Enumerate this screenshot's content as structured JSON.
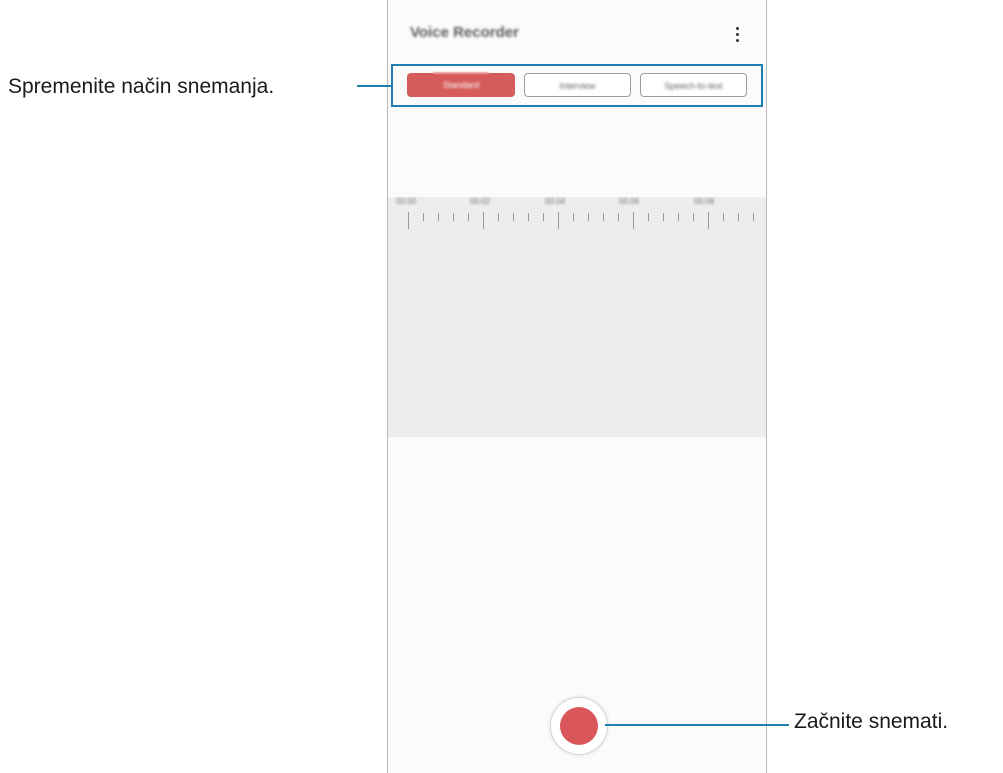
{
  "app": {
    "title": "Voice Recorder"
  },
  "modes": [
    {
      "label": "Standard",
      "selected": true
    },
    {
      "label": "Interview",
      "selected": false
    },
    {
      "label": "Speech-to-text",
      "selected": false
    }
  ],
  "timeline": {
    "tick_labels": [
      "00:00",
      "00:02",
      "00:04",
      "00:06",
      "00:08"
    ]
  },
  "callouts": {
    "mode": "Spremenite način snemanja.",
    "record": "Začnite snemati."
  },
  "colors": {
    "accent_red": "#d9575a",
    "callout_blue": "#1f7fb0"
  },
  "icons": {
    "more": "more-vertical-icon",
    "record": "record-icon"
  }
}
